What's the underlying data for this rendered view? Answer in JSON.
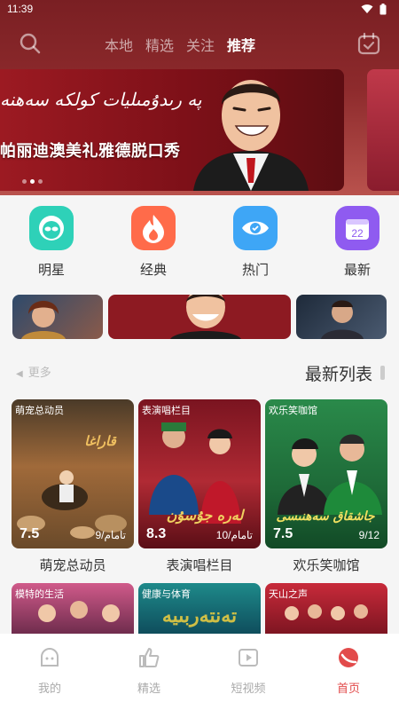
{
  "status": {
    "time": "11:39"
  },
  "header": {
    "tabs": [
      {
        "label": "本地",
        "active": false
      },
      {
        "label": "精选",
        "active": false
      },
      {
        "label": "关注",
        "active": false
      },
      {
        "label": "推荐",
        "active": true
      }
    ]
  },
  "banner": {
    "script_text": "ﭘﻪ ﺭﯨﺪﯗﻣﯩﻠﻴﺎﺕ ﻛﻮﻟﻜﻪ ﺳﻪﮬﻨﻪ",
    "title": "帕丽迪澳美礼雅德脱口秀",
    "dots": 3,
    "active_dot": 2
  },
  "categories": [
    {
      "label": "明星",
      "icon": "star-face-icon",
      "color": "#2ed1b8"
    },
    {
      "label": "经典",
      "icon": "flame-icon",
      "color": "#ff6b4a"
    },
    {
      "label": "热门",
      "icon": "eye-icon",
      "color": "#3ea6f6"
    },
    {
      "label": "最新",
      "icon": "calendar-icon",
      "color": "#8f5bf0",
      "badge": "22"
    }
  ],
  "section": {
    "more_label": "更多",
    "title": "最新列表"
  },
  "cards": [
    {
      "tag": "萌宠总动员",
      "poster_text": "ﻗﺎﺭﺍﻏﺎ",
      "score": "7.5",
      "episodes": "9/تامام",
      "title": "萌宠总动员"
    },
    {
      "tag": "表演唱栏目",
      "poster_text": "ﻟﻪﺭﻩ ﺟﯘﺳﯘﻥ",
      "score": "8.3",
      "episodes": "10/تامام",
      "title": "表演唱栏目"
    },
    {
      "tag": "欢乐笑咖馆",
      "poster_text": "ﺟﺎﺷﻘﺎﻕ ﺳﻪﮬﻨﯩﺴﻰ",
      "score": "7.5",
      "episodes": "9/12",
      "title": "欢乐笑咖馆"
    }
  ],
  "cards_row2": [
    {
      "tag": "模特的生活"
    },
    {
      "tag": "健康与体育"
    },
    {
      "tag": "天山之声"
    }
  ],
  "nav": [
    {
      "label": "我的",
      "icon": "profile-icon",
      "active": false
    },
    {
      "label": "精选",
      "icon": "thumbs-up-icon",
      "active": false
    },
    {
      "label": "短视频",
      "icon": "short-video-icon",
      "active": false
    },
    {
      "label": "首页",
      "icon": "home-icon",
      "active": true
    }
  ],
  "colors": {
    "header": "#7a1f23",
    "accent": "#e24b4b"
  }
}
